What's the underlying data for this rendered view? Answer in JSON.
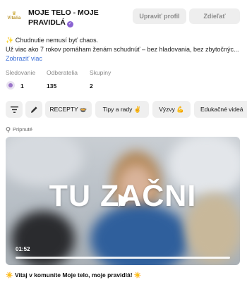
{
  "profile": {
    "logo_brand": "Vitalia",
    "name": "MOJE TELO - MOJE PRAVIDLÁ",
    "edit_button": "Upraviť profil",
    "share_button": "Zdieľať",
    "bio_line1": "✨ Chudnutie nemusí byť chaos.",
    "bio_line2": "Už viac ako 7 rokov pomáham ženám schudnúť – bez hladovania, bez zbytočnýc...",
    "show_more": "Zobraziť viac"
  },
  "stats": [
    {
      "label": "Sledovanie",
      "value": "1"
    },
    {
      "label": "Odberatelia",
      "value": "135"
    },
    {
      "label": "Skupiny",
      "value": "2"
    }
  ],
  "chips": [
    {
      "label": "RECEPTY 🍲"
    },
    {
      "label": "Tipy a rady ✌️"
    },
    {
      "label": "Výzvy 💪"
    },
    {
      "label": "Edukačné videá"
    }
  ],
  "pinned_label": "Pripnuté",
  "video": {
    "overlay_text": "TU ZAČNI",
    "duration": "01:52",
    "progress": 0
  },
  "post_caption": "☀️ Vitaj v komunite Moje telo, moje pravidlá! ☀️",
  "colors": {
    "accent_link": "#3b6fd8",
    "verified": "#8a63d2",
    "button_bg": "#eeeeee"
  }
}
